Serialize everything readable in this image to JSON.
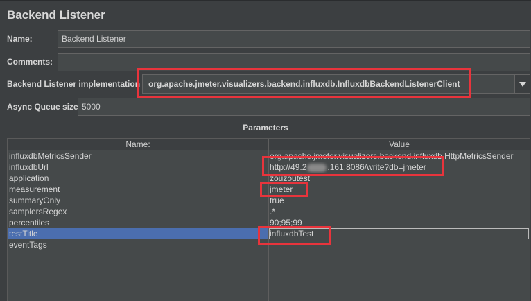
{
  "panel": {
    "title": "Backend Listener"
  },
  "form": {
    "name_label": "Name:",
    "name_value": "Backend Listener",
    "comments_label": "Comments:",
    "comments_value": "",
    "impl_label": "Backend Listener implementation",
    "impl_value": "org.apache.jmeter.visualizers.backend.influxdb.InfluxdbBackendListenerClient",
    "queue_label": "Async Queue size",
    "queue_value": "5000"
  },
  "params": {
    "title": "Parameters",
    "columns": {
      "name": "Name:",
      "value": "Value"
    },
    "rows": [
      {
        "name": "influxdbMetricsSender",
        "value": "org.apache.jmeter.visualizers.backend.influxdb.HttpMetricsSender"
      },
      {
        "name": "influxdbUrl",
        "value_prefix": "http://49.2",
        "value_suffix": ".161:8086/write?db=jmeter"
      },
      {
        "name": "application",
        "value": "zouzoutest"
      },
      {
        "name": "measurement",
        "value": "jmeter"
      },
      {
        "name": "summaryOnly",
        "value": "true"
      },
      {
        "name": "samplersRegex",
        "value": ".*"
      },
      {
        "name": "percentiles",
        "value": "90;95;99"
      },
      {
        "name": "testTitle",
        "value": "influxdbTest"
      },
      {
        "name": "eventTags",
        "value": ""
      }
    ],
    "selected_row": "testTitle"
  },
  "colors": {
    "background": "#3c3f41",
    "selection": "#4b6eaf",
    "annotation": "#e8343c"
  }
}
